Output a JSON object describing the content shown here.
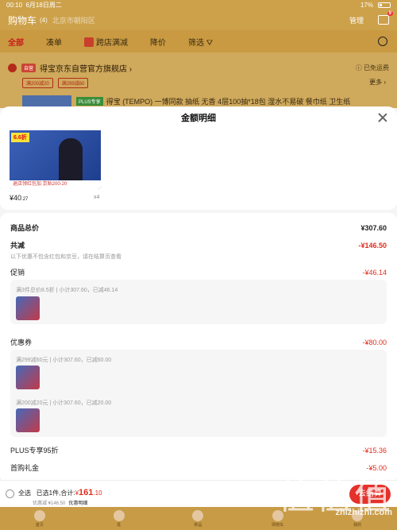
{
  "status": {
    "time": "00:10",
    "date": "6月18日周二",
    "battery": "17%"
  },
  "header": {
    "title": "购物车",
    "count": "(4)",
    "address": "北京市朝阳区",
    "manage": "管理",
    "msg_count": "9"
  },
  "filters": [
    "全部",
    "凑单",
    "跨店满减",
    "降价",
    "筛选"
  ],
  "shop": {
    "tag": "自营",
    "name": "得宝京东自营官方旗舰店 ›",
    "service": "ⓘ 已免运费",
    "coupons": [
      "满200减20",
      "满299减60"
    ],
    "more": "更多 ›",
    "product_tag": "PLUS专享",
    "product_title": "得宝 (TEMPO) 一博同款 抽纸 无香 4层100抽*18包 湿水不易破 餐巾纸 卫生纸"
  },
  "sheet": {
    "title": "金额明细",
    "promo_badge": "6.6折",
    "img_foot": "退店领红包加 京贴200-20",
    "price_yen": "¥",
    "price_int": "40",
    "price_dec": ".27",
    "qty": "x4"
  },
  "rows": {
    "goods_label": "商品总价",
    "goods_val": "¥307.60",
    "reduce_label": "共减",
    "reduce_val": "-¥146.50",
    "reduce_note": "以下优惠不包含红包和京豆，请在结算页查看",
    "promo_label": "促销",
    "promo_val": "-¥46.14",
    "promo_detail": "满3件总价8.5折 | 小计307.60，已减46.14",
    "coupon_label": "优惠券",
    "coupon_val": "-¥80.00",
    "coupon_detail1": "满299减60元 | 小计307.60，已减60.00",
    "coupon_detail2": "满200减20元 | 小计307.60，已减20.00",
    "plus_label": "PLUS专享95折",
    "plus_val": "-¥15.36",
    "first_label": "首购礼金",
    "first_val": "-¥5.00"
  },
  "bottom": {
    "select_all": "全选",
    "selected": "已选1件,合计:",
    "yen": "¥",
    "total": "161",
    "total_dec": ".10",
    "saved": "优惠减 ¥146.50",
    "detail": "优惠明细",
    "settle": "去结算"
  },
  "tabs": [
    "首页",
    "逛",
    "新品",
    "购物车",
    "我的"
  ],
  "watermark": "zhizhizhi.com",
  "watermark_glyph": "值值值"
}
